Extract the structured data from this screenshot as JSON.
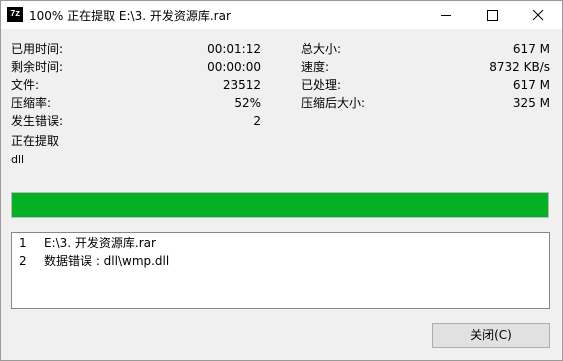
{
  "window": {
    "title": "100% 正在提取 E:\\3. 开发资源库.rar",
    "icon_text": "7z"
  },
  "stats": {
    "left": [
      {
        "label": "已用时间:",
        "value": "00:01:12"
      },
      {
        "label": "剩余时间:",
        "value": "00:00:00"
      },
      {
        "label": "文件:",
        "value": "23512"
      },
      {
        "label": "压缩率:",
        "value": "52%"
      },
      {
        "label": "发生错误:",
        "value": "2"
      }
    ],
    "right": [
      {
        "label": "总大小:",
        "value": "617 M"
      },
      {
        "label": "速度:",
        "value": "8732 KB/s"
      },
      {
        "label": "已处理:",
        "value": "617 M"
      },
      {
        "label": "压缩后大小:",
        "value": "325 M"
      }
    ]
  },
  "status": {
    "operation": "正在提取",
    "current_item": "dll"
  },
  "progress": {
    "percent": 100,
    "color": "#06b025"
  },
  "log": [
    {
      "num": "1",
      "message": "E:\\3. 开发资源库.rar"
    },
    {
      "num": "2",
      "message": "数据错误 : dll\\wmp.dll"
    }
  ],
  "buttons": {
    "close_label": "关闭(C)"
  },
  "icons": {
    "minimize": "minimize-icon",
    "maximize": "maximize-icon",
    "close": "close-icon"
  }
}
